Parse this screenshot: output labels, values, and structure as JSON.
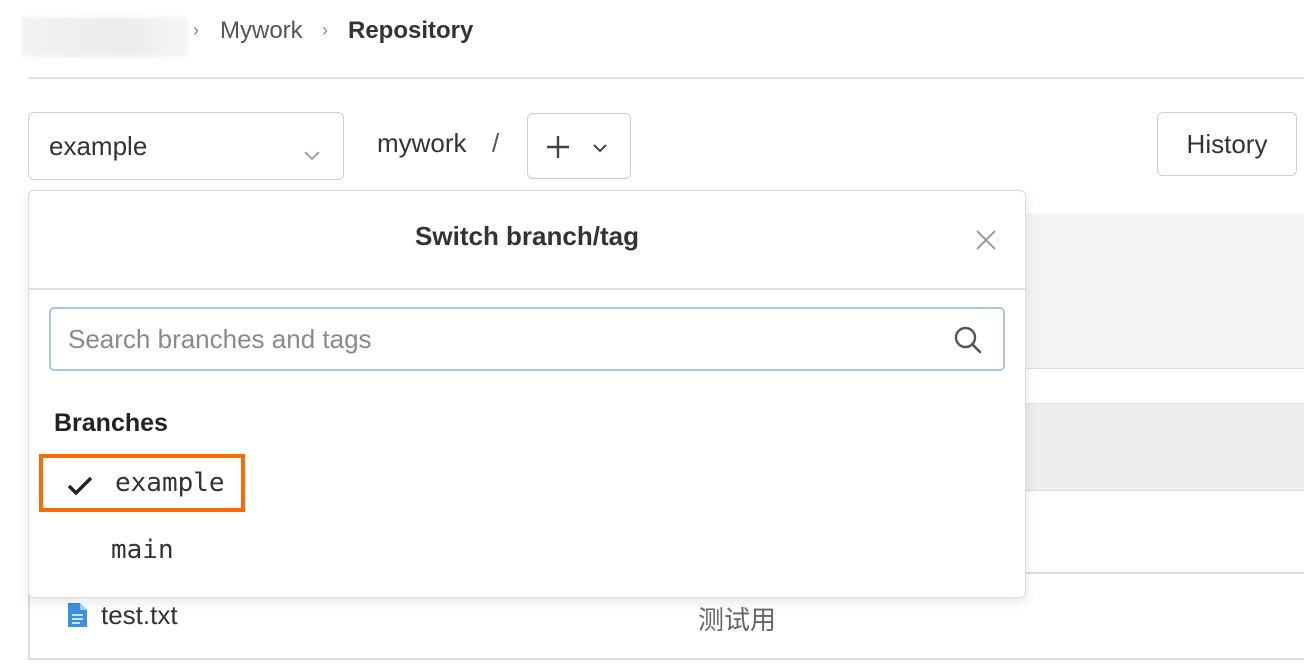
{
  "breadcrumb": {
    "separator": "›",
    "items": [
      {
        "label": "Mywork"
      },
      {
        "label": "Repository"
      }
    ]
  },
  "toolbar": {
    "branch_select_value": "example",
    "path_label": "mywork",
    "path_separator": "/",
    "history_label": "History"
  },
  "dropdown": {
    "title": "Switch branch/tag",
    "search_placeholder": "Search branches and tags",
    "section_label": "Branches",
    "branches": [
      {
        "name": "example",
        "selected": true
      },
      {
        "name": "main",
        "selected": false
      }
    ]
  },
  "files": [
    {
      "name": "test.txt",
      "description": "测试用"
    }
  ],
  "colors": {
    "highlight": "#ff6a00",
    "search_border": "#a9c6e6",
    "file_icon": "#3b8fe6"
  }
}
